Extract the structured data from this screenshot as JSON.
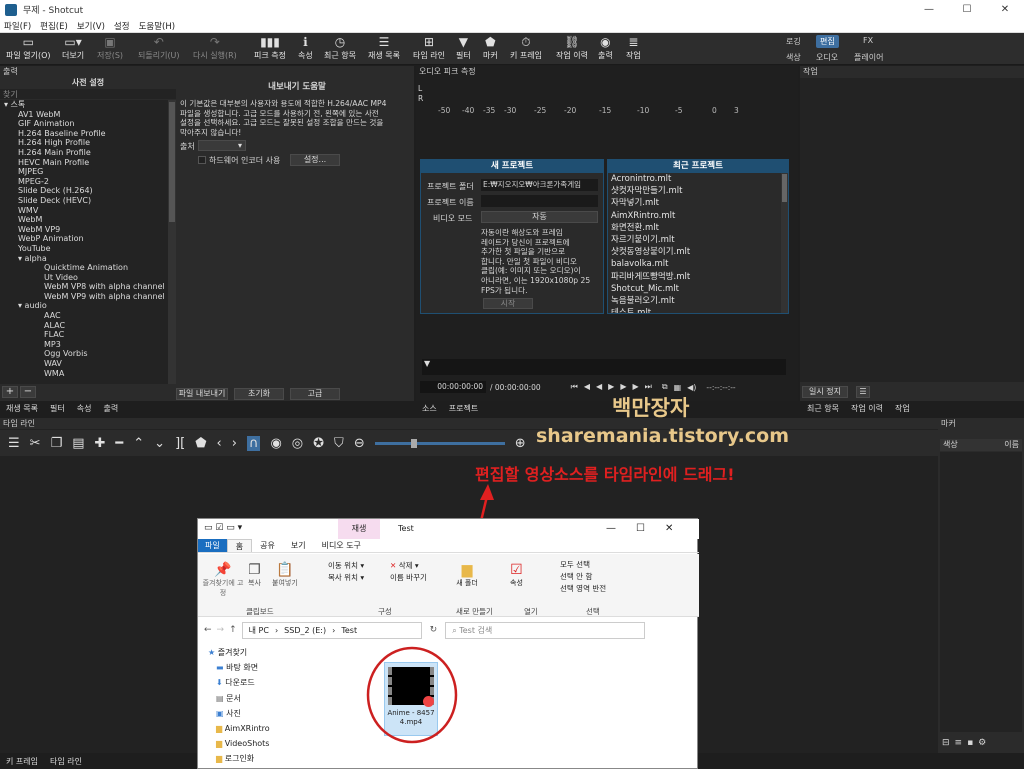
{
  "window": {
    "title": "무제 - Shotcut",
    "min": "—",
    "max": "☐",
    "close": "✕"
  },
  "menu": [
    "파일(F)",
    "편집(E)",
    "보기(V)",
    "설정",
    "도움말(H)"
  ],
  "toolbar": [
    {
      "label": "파일 열기(O)",
      "icon": "open-icon",
      "glyph": "▭",
      "dim": false
    },
    {
      "label": "더보기",
      "icon": "more-icon",
      "glyph": "▭▾",
      "dim": false
    },
    {
      "label": "저장(S)",
      "icon": "save-icon",
      "glyph": "▣",
      "dim": true
    },
    {
      "label": "되돌리기(U)",
      "icon": "undo-icon",
      "glyph": "↶",
      "dim": true
    },
    {
      "label": "다시 실행(R)",
      "icon": "redo-icon",
      "glyph": "↷",
      "dim": true
    },
    {
      "label": "피크 측정",
      "icon": "peak-meter-icon",
      "glyph": "▮▮▮",
      "dim": false
    },
    {
      "label": "속성",
      "icon": "properties-icon",
      "glyph": "ℹ",
      "dim": false
    },
    {
      "label": "최근 항목",
      "icon": "recent-icon",
      "glyph": "◷",
      "dim": false
    },
    {
      "label": "재생 목록",
      "icon": "playlist-icon",
      "glyph": "☰",
      "dim": false
    },
    {
      "label": "타임 라인",
      "icon": "timeline-icon",
      "glyph": "⊞",
      "dim": false
    },
    {
      "label": "필터",
      "icon": "filter-icon",
      "glyph": "▼",
      "dim": false
    },
    {
      "label": "마커",
      "icon": "marker-icon",
      "glyph": "⬟",
      "dim": false
    },
    {
      "label": "키 프레임",
      "icon": "keyframe-icon",
      "glyph": "⏱",
      "dim": false
    },
    {
      "label": "작업 이력",
      "icon": "history-icon",
      "glyph": "⛓",
      "dim": false
    },
    {
      "label": "출력",
      "icon": "export-icon",
      "glyph": "◉",
      "dim": false
    },
    {
      "label": "작업",
      "icon": "jobs-icon",
      "glyph": "≣",
      "dim": false
    }
  ],
  "layouts": {
    "row1": [
      "로깅",
      "편집",
      "FX"
    ],
    "row2": [
      "색상",
      "오디오",
      "플레이어"
    ],
    "active": "편집"
  },
  "export_panel": {
    "header": "출력",
    "presets_title": "사전 설정",
    "search_placeholder": "찾기",
    "tree": [
      {
        "text": "▾ 스톡",
        "indent": 0
      },
      {
        "text": "AV1 WebM",
        "indent": 1
      },
      {
        "text": "GIF Animation",
        "indent": 1
      },
      {
        "text": "H.264 Baseline Profile",
        "indent": 1
      },
      {
        "text": "H.264 High Profile",
        "indent": 1
      },
      {
        "text": "H.264 Main Profile",
        "indent": 1
      },
      {
        "text": "HEVC Main Profile",
        "indent": 1
      },
      {
        "text": "MJPEG",
        "indent": 1
      },
      {
        "text": "MPEG-2",
        "indent": 1
      },
      {
        "text": "Slide Deck (H.264)",
        "indent": 1
      },
      {
        "text": "Slide Deck (HEVC)",
        "indent": 1
      },
      {
        "text": "WMV",
        "indent": 1
      },
      {
        "text": "WebM",
        "indent": 1
      },
      {
        "text": "WebM VP9",
        "indent": 1
      },
      {
        "text": "WebP Animation",
        "indent": 1
      },
      {
        "text": "YouTube",
        "indent": 1
      },
      {
        "text": "▾ alpha",
        "indent": 1
      },
      {
        "text": "Quicktime Animation",
        "indent": 2
      },
      {
        "text": "Ut Video",
        "indent": 2
      },
      {
        "text": "WebM VP8 with alpha channel",
        "indent": 2
      },
      {
        "text": "WebM VP9 with alpha channel",
        "indent": 2
      },
      {
        "text": "▾ audio",
        "indent": 1
      },
      {
        "text": "AAC",
        "indent": 2
      },
      {
        "text": "ALAC",
        "indent": 2
      },
      {
        "text": "FLAC",
        "indent": 2
      },
      {
        "text": "MP3",
        "indent": 2
      },
      {
        "text": "Ogg Vorbis",
        "indent": 2
      },
      {
        "text": "WAV",
        "indent": 2
      },
      {
        "text": "WMA",
        "indent": 2
      }
    ],
    "help_title": "내보내기 도움말",
    "help_lines": [
      "이 기본값은 대부분의 사용자와 용도에 적합한 H.264/AAC MP4",
      "파일을 생성합니다. 고급 모드를 사용하기 전, 왼쪽에 있는 사전",
      "설정을 선택하세요. 고급 모드는 잘못된 설정 조합을 만드는 것을",
      "막아주지 않습니다!"
    ],
    "source_label": "출처",
    "hw_encoder_label": "하드웨어 인코더 사용",
    "settings_button": "설정...",
    "export_button": "파일 내보내기",
    "reset_button": "초기화",
    "advanced_button": "고급",
    "add": "+",
    "remove": "−"
  },
  "left_tabs": [
    "재생 목록",
    "필터",
    "속성",
    "출력"
  ],
  "audio_panel": {
    "header": "오디오 피크 측정",
    "channels": [
      "L",
      "R"
    ],
    "scale": [
      "-50",
      "-40",
      "-35",
      "-30",
      "-25",
      "-20",
      "-15",
      "-10",
      "-5",
      "0",
      "3"
    ]
  },
  "new_project": {
    "title": "새 프로젝트",
    "folder_label": "프로젝트 폴더",
    "folder_value": "E:₩지오지오₩아크론가족게임",
    "name_label": "프로젝트 이름",
    "name_value": "",
    "video_mode_label": "비디오 모드",
    "video_mode_value": "자동",
    "desc_lines": [
      "자동이란 해상도와 프레임",
      "레이트가 당신이 프로젝트에",
      "추가한 첫 파일을 기반으로",
      "합니다. 만일 첫 파일이 비디오",
      "클립(예: 이미지 또는 오디오)이",
      "아니라면, 이는 1920x1080p 25",
      "FPS가 됩니다."
    ],
    "start_button": "시작"
  },
  "recent_projects": {
    "title": "최근 프로젝트",
    "items": [
      "Acronintro.mlt",
      "샷컷자막만들기.mlt",
      "자막넣기.mlt",
      "AimXRintro.mlt",
      "화면전환.mlt",
      "자르기붙이기.mlt",
      "샷컷동영상붙이기.mlt",
      "balavolka.mlt",
      "파리바게뜨빵먹방.mlt",
      "Shotcut_Mic.mlt",
      "녹음불러오기.mlt",
      "테스트.mlt"
    ]
  },
  "player": {
    "timecode": "00:00:00:00",
    "duration": "/ 00:00:00:00",
    "in_out": "--:--:--:--",
    "tabs": [
      "소스",
      "프로젝트"
    ]
  },
  "jobs_panel": {
    "header": "작업",
    "pause_button": "일시 정지",
    "menu_button": "☰",
    "tabs": [
      "최근 항목",
      "작업 이력",
      "작업"
    ]
  },
  "timeline": {
    "header": "타임 라인",
    "bottom_tabs": [
      "키 프레임",
      "타임 라인"
    ]
  },
  "markers": {
    "header": "마커",
    "col_color": "색상",
    "col_name": "이름"
  },
  "watermark": {
    "line1": "백만장자",
    "line2": "sharemania.tistory.com"
  },
  "annotation": {
    "text": "편집할 영상소스를 타임라인에 드래그!",
    "color": "#e02020"
  },
  "explorer": {
    "title": "Test",
    "context_tab": "재생",
    "context_tab_sub": "비디오 도구",
    "tabs": [
      "파일",
      "홈",
      "공유",
      "보기"
    ],
    "ribbon": {
      "clipboard": [
        "즐겨찾기에 고정",
        "복사",
        "붙여넣기"
      ],
      "clipboard_label": "클립보드",
      "organize": [
        "이동 위치 ▾",
        "삭제 ▾",
        "복사 위치 ▾",
        "이름 바꾸기"
      ],
      "organize_label": "구성",
      "new": [
        "새 폴더"
      ],
      "new_label": "새로 만들기",
      "open": [
        "속성"
      ],
      "open_label": "열기",
      "select": [
        "모두 선택",
        "선택 안 함",
        "선택 영역 반전"
      ],
      "select_label": "선택"
    },
    "breadcrumb": [
      "내 PC",
      "SSD_2 (E:)",
      "Test"
    ],
    "search_placeholder": "Test 검색",
    "nav": [
      "즐겨찾기",
      "바탕 화면",
      "다운로드",
      "문서",
      "사진",
      "AimXRintro",
      "VideoShots",
      "로그인화"
    ],
    "file_name": "Anime - 84574.mp4"
  }
}
